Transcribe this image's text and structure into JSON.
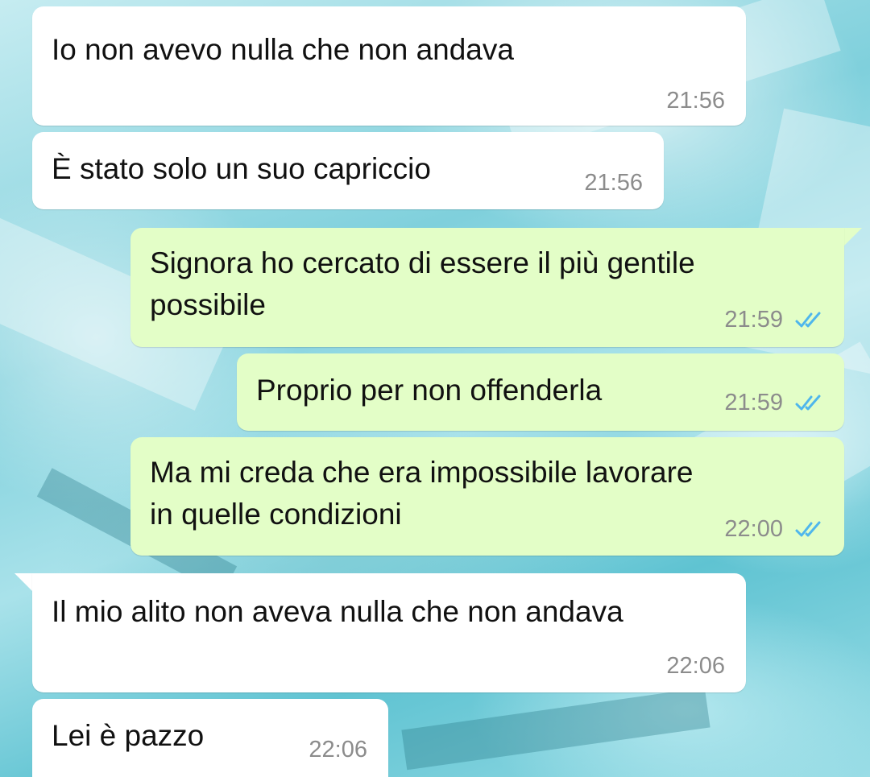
{
  "chat": {
    "messages": [
      {
        "direction": "incoming",
        "text": "Io non avevo nulla che non andava",
        "time": "21:56"
      },
      {
        "direction": "incoming",
        "text": "È stato solo un suo capriccio",
        "time": "21:56"
      },
      {
        "direction": "outgoing",
        "line1": "Signora ho cercato di essere il più gentile",
        "line2": "possibile",
        "time": "21:59",
        "status": "read-double-check-icon"
      },
      {
        "direction": "outgoing",
        "text": "Proprio per non offenderla",
        "time": "21:59",
        "status": "read-double-check-icon"
      },
      {
        "direction": "outgoing",
        "line1": "Ma mi creda che era impossibile lavorare",
        "line2": "in quelle condizioni",
        "time": "22:00",
        "status": "read-double-check-icon"
      },
      {
        "direction": "incoming",
        "text": "Il mio alito non aveva nulla che non andava",
        "time": "22:06"
      },
      {
        "direction": "incoming",
        "text": "Lei è pazzo",
        "time": "22:06"
      }
    ]
  },
  "colors": {
    "incoming_bubble": "#ffffff",
    "outgoing_bubble": "#e3fec7",
    "read_tick": "#4fb6ec",
    "timestamp": "#8c8c8c"
  }
}
